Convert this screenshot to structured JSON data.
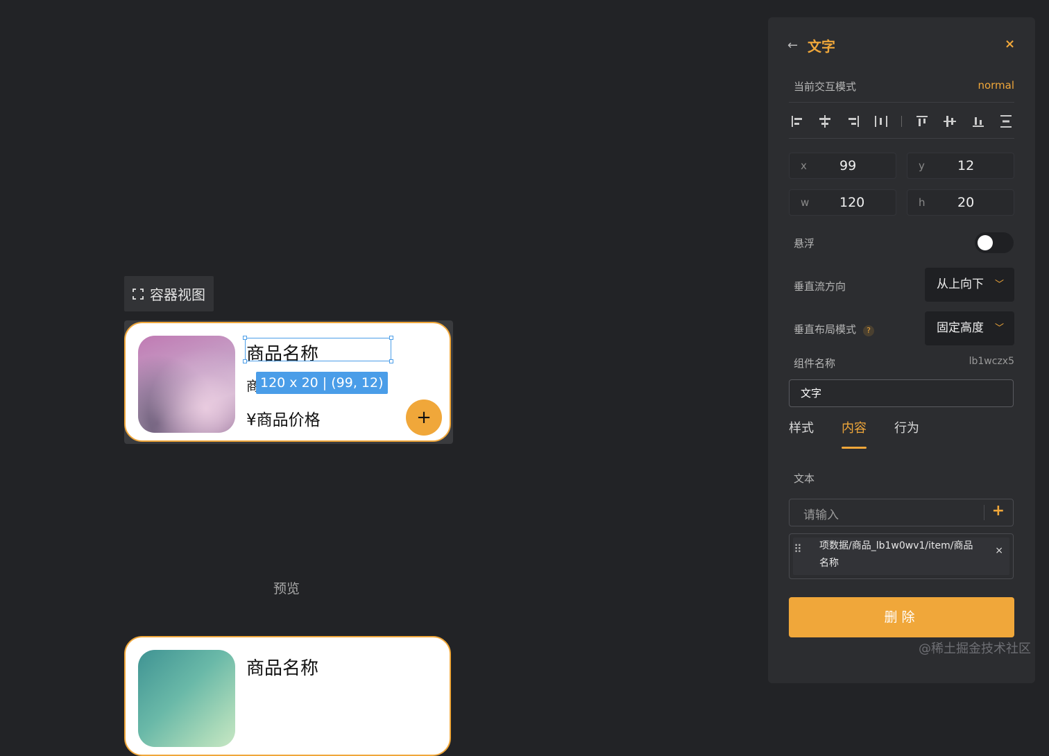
{
  "canvas": {
    "container_view_label": "容器视图",
    "card": {
      "name": "商品名称",
      "sub_prefix": "商",
      "dimension_tag": "120 x 20 | (99, 12)",
      "price": "¥商品价格",
      "add_symbol": "+"
    },
    "preview_label": "预览",
    "preview_card": {
      "name": "商品名称"
    }
  },
  "panel": {
    "title": "文字",
    "back_symbol": "←",
    "close_symbol": "×",
    "mode_label": "当前交互模式",
    "mode_value": "normal",
    "x_label": "x",
    "x_value": "99",
    "y_label": "y",
    "y_value": "12",
    "w_label": "w",
    "w_value": "120",
    "h_label": "h",
    "h_value": "20",
    "float_label": "悬浮",
    "float_on": false,
    "vflow_label": "垂直流方向",
    "vflow_value": "从上向下",
    "vlayout_label": "垂直布局模式",
    "vlayout_help": "?",
    "vlayout_value": "固定高度",
    "component_name_label": "组件名称",
    "component_id": "lb1wczx5",
    "component_name_value": "文字",
    "tabs": [
      "样式",
      "内容",
      "行为"
    ],
    "active_tab": "内容",
    "text_label": "文本",
    "text_placeholder": "请输入",
    "text_add_symbol": "+",
    "binding_text": "项数据/商品_lb1w0wv1/item/商品名称",
    "binding_remove_symbol": "×",
    "delete_label": "删除"
  },
  "watermark": "@稀土掘金技术社区",
  "colors": {
    "accent": "#f0a73a",
    "selection": "#4a9de8",
    "background": "#222326",
    "panel": "#2c2d30"
  }
}
